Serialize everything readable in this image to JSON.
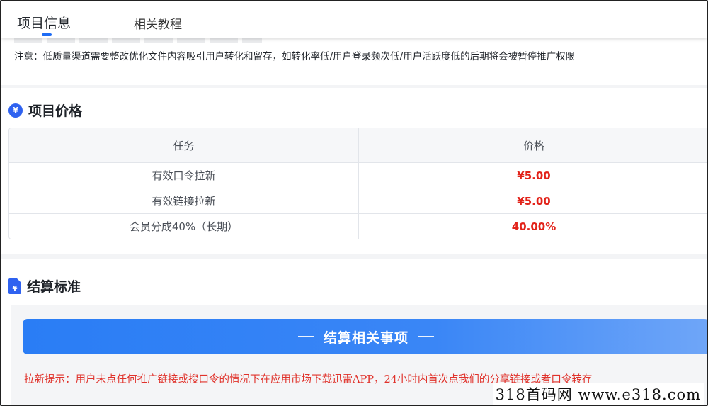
{
  "tabs": [
    {
      "label": "项目信息",
      "active": true
    },
    {
      "label": "相关教程",
      "active": false
    }
  ],
  "notice": {
    "text": "注意：低质量渠道需要整改优化文件内容吸引用户转化和留存，如转化率低/用户登录频次低/用户活跃度低的后期将会被暂停推广权限"
  },
  "price_section": {
    "icon_glyph": "¥",
    "title": "项目价格",
    "columns": [
      "任务",
      "价格"
    ],
    "rows": [
      {
        "task": "有效口令拉新",
        "price": "¥5.00"
      },
      {
        "task": "有效链接拉新",
        "price": "¥5.00"
      },
      {
        "task": "会员分成40%（长期）",
        "price": "40.00%"
      }
    ]
  },
  "settle_section": {
    "icon_glyph": "¥",
    "title": "结算标准",
    "button_label": "结算相关事项",
    "hint": "拉新提示：用户未点任何推广链接或搜口令的情况下在应用市场下载迅雷APP，24小时内首次点我们的分享链接或者口令转存"
  },
  "watermark": "318首码网  www.e318.com",
  "colors": {
    "accent": "#1e6cf5",
    "price_red": "#e2231a",
    "hint_red": "#e0322b"
  }
}
